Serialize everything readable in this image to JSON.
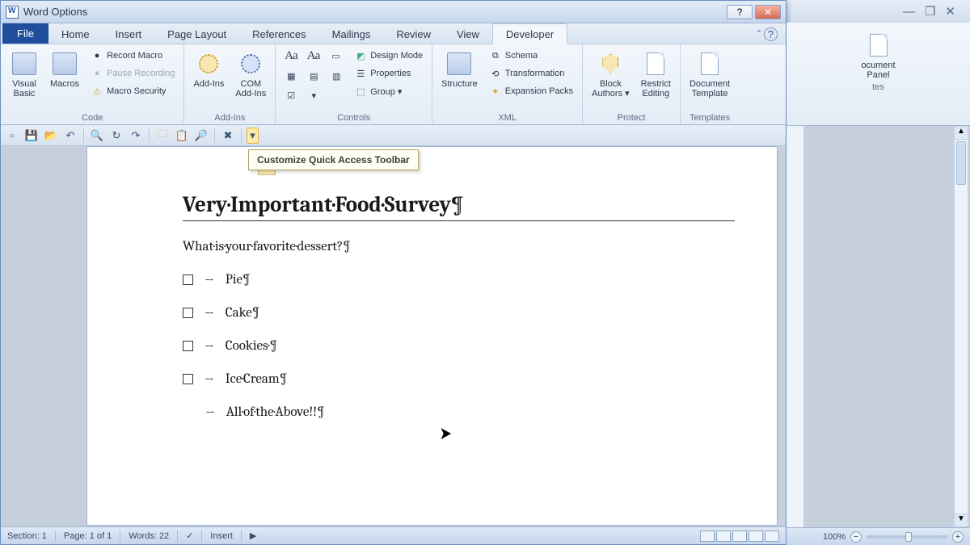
{
  "outer_window": {
    "min_icon": "—",
    "restore_icon": "❐",
    "close_icon": "✕"
  },
  "wo": {
    "title": "Word Options",
    "help_icon": "?",
    "close_icon": "✕"
  },
  "tabs": {
    "file": "File",
    "items": [
      "Home",
      "Insert",
      "Page Layout",
      "References",
      "Mailings",
      "Review",
      "View",
      "Developer"
    ],
    "active": "Developer",
    "help_chevron": "ˆ",
    "help_q": "?"
  },
  "ribbon": {
    "code": {
      "label": "Code",
      "visual_basic": "Visual\nBasic",
      "macros": "Macros",
      "record": "Record Macro",
      "pause": "Pause Recording",
      "security": "Macro Security"
    },
    "addins": {
      "label": "Add-Ins",
      "addins": "Add-Ins",
      "com": "COM\nAdd-Ins"
    },
    "controls": {
      "label": "Controls",
      "design": "Design Mode",
      "properties": "Properties",
      "group": "Group ▾"
    },
    "xml": {
      "label": "XML",
      "structure": "Structure",
      "schema": "Schema",
      "transformation": "Transformation",
      "expansion": "Expansion Packs"
    },
    "protect": {
      "label": "Protect",
      "block": "Block\nAuthors ▾",
      "restrict": "Restrict\nEditing"
    },
    "templates": {
      "label": "Templates",
      "docpanel": "Document\nPanel",
      "doctmpl": "Document\nTemplate"
    }
  },
  "qat": {
    "tooltip": "Customize Quick Access Toolbar"
  },
  "document": {
    "title": "Very·Important·Food·Survey¶",
    "question": "What·is·your·favorite·dessert?¶",
    "items": [
      "Pie¶",
      "Cake¶",
      "Cookies·¶",
      "Ice·Cream¶"
    ],
    "last": "All·of·the·Above!!¶"
  },
  "status": {
    "section": "Section: 1",
    "page": "Page: 1 of 1",
    "words": "Words: 22",
    "insert": "Insert"
  },
  "zoom": {
    "pct": "100%"
  },
  "outer_ribbon": {
    "panel_label": "tes",
    "btn": "ocument\nPanel"
  }
}
